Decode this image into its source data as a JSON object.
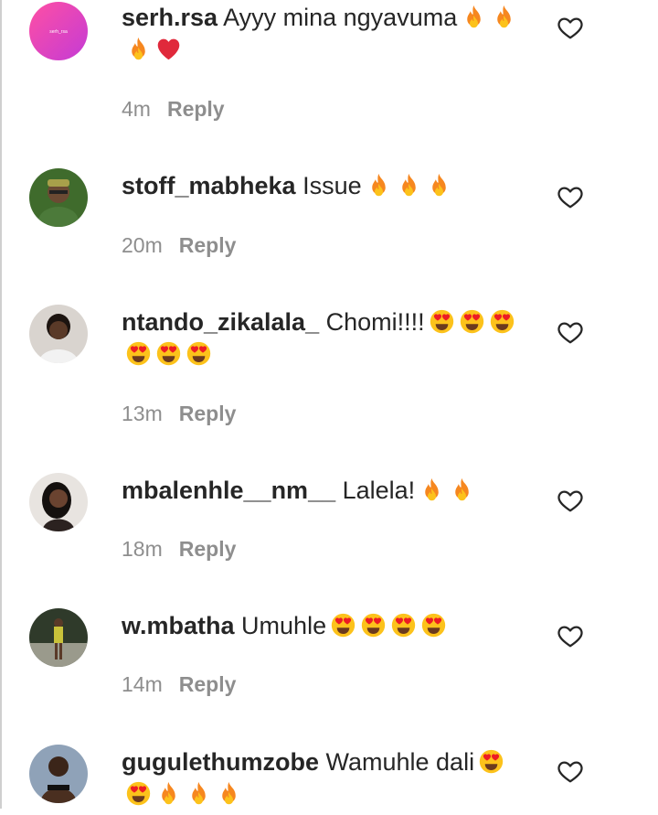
{
  "reply_label": "Reply",
  "comments": [
    {
      "username": "serh.rsa",
      "text": "Ayyy mina ngyavuma",
      "emojis": [
        "fire",
        "fire",
        "fire",
        "heart"
      ],
      "time": "4m",
      "avatar_text": "serh_rsa"
    },
    {
      "username": "stoff_mabheka",
      "text": "Issue",
      "emojis": [
        "fire",
        "fire",
        "fire"
      ],
      "time": "20m"
    },
    {
      "username": "ntando_zikalala_",
      "text": "Chomi!!!!",
      "emojis": [
        "heart-eyes",
        "heart-eyes",
        "heart-eyes",
        "heart-eyes",
        "heart-eyes",
        "heart-eyes"
      ],
      "time": "13m"
    },
    {
      "username": "mbalenhle__nm__",
      "text": "Lalela!",
      "emojis": [
        "fire",
        "fire"
      ],
      "time": "18m"
    },
    {
      "username": "w.mbatha",
      "text": "Umuhle",
      "emojis": [
        "heart-eyes",
        "heart-eyes",
        "heart-eyes",
        "heart-eyes"
      ],
      "time": "14m"
    },
    {
      "username": "gugulethumzobe",
      "text": "Wamuhle dali",
      "emojis": [
        "heart-eyes",
        "heart-eyes",
        "fire",
        "fire",
        "fire"
      ],
      "time": ""
    }
  ]
}
